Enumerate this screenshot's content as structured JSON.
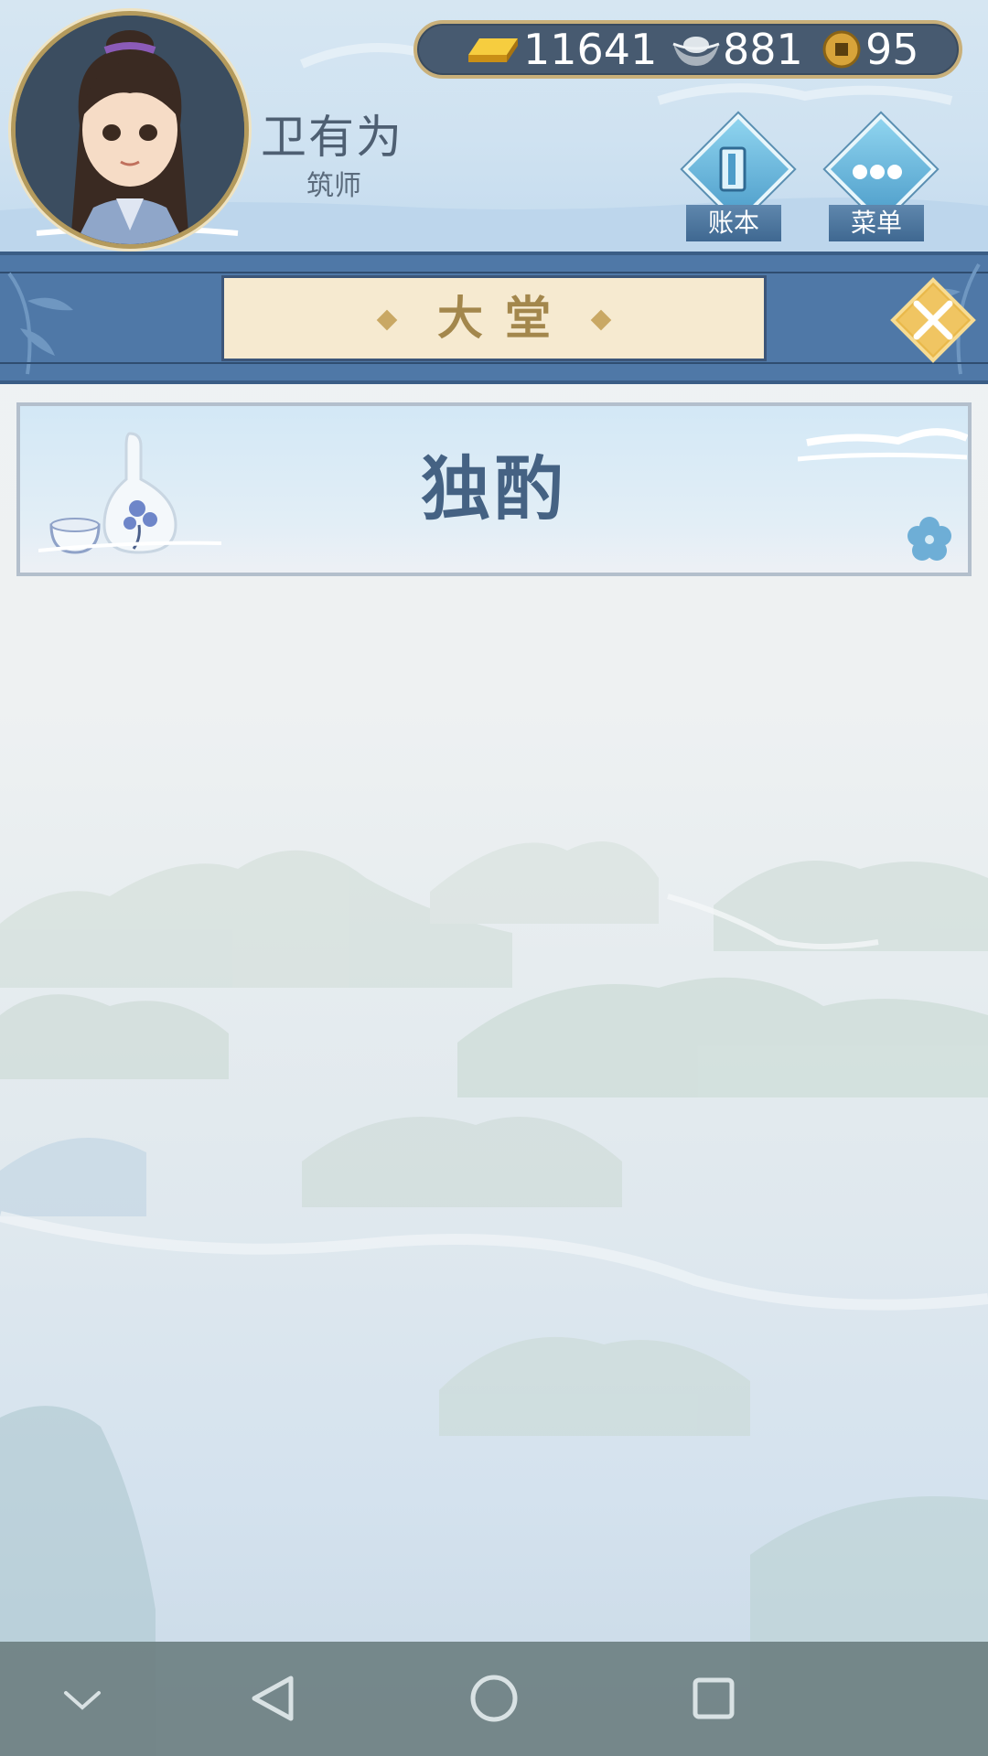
{
  "player": {
    "name": "卫有为",
    "title": "筑师"
  },
  "currency": {
    "gold": "11641",
    "silver": "881",
    "copper": "95"
  },
  "hud_buttons": {
    "ledger_label": "账本",
    "menu_label": "菜单"
  },
  "banner": {
    "title": "大堂"
  },
  "list": {
    "items": [
      {
        "label": "独酌"
      }
    ]
  },
  "icons": {
    "gold": "gold-ingot-icon",
    "silver": "silver-ingot-icon",
    "copper": "copper-coin-icon",
    "ledger": "ledger-icon",
    "menu": "more-dots-icon",
    "close": "close-icon",
    "nav": [
      "nav-collapse-icon",
      "nav-back-icon",
      "nav-home-icon",
      "nav-recents-icon"
    ]
  },
  "colors": {
    "banner": "#4f78a7",
    "plaque": "#f6ead0",
    "accent_gold": "#e9b84a",
    "text_dark": "#456283"
  }
}
